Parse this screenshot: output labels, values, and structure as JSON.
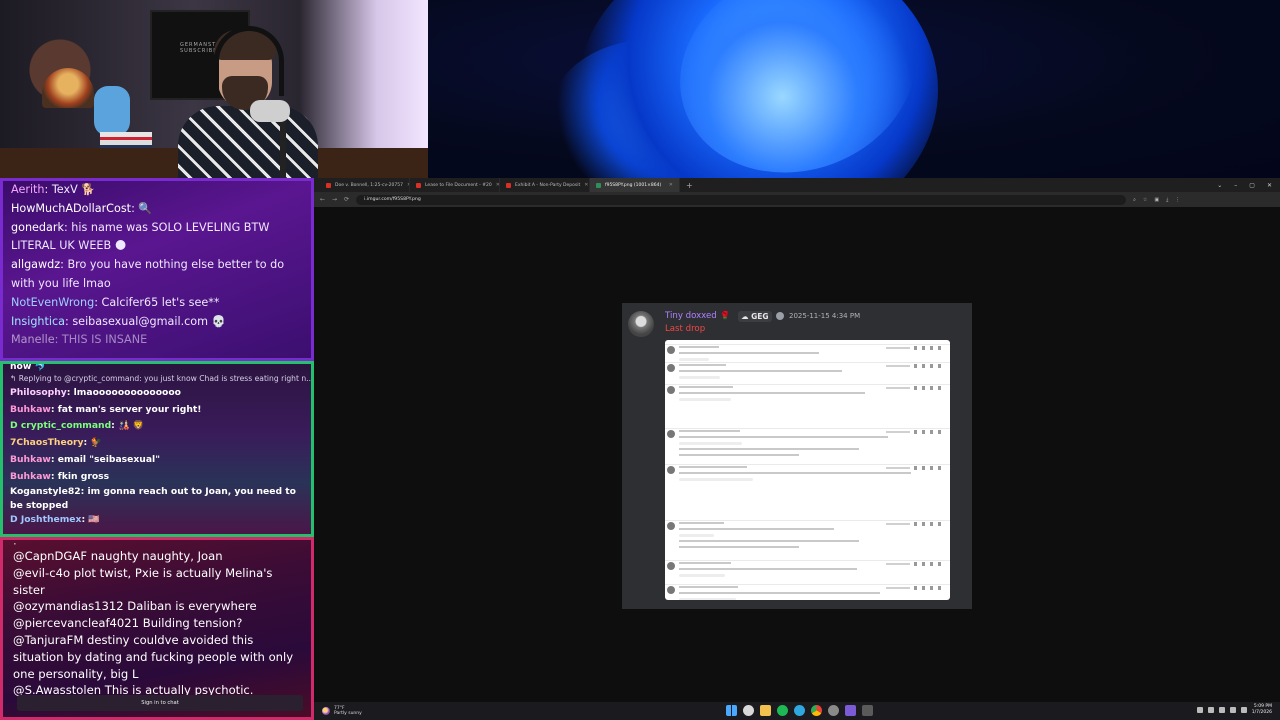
{
  "webcam": {
    "sign_text": "GERMANSTICK\nSUBSCRIBER"
  },
  "chat_top": {
    "messages": [
      {
        "user": "Aerith",
        "user_color": "#f6a6ff",
        "text": ": TexV 🐕"
      },
      {
        "user": "HowMuchADollarCost",
        "user_color": "#ffffff",
        "text": ":  🔍"
      },
      {
        "user": "gonedark",
        "user_color": "#ffffff",
        "text": ": his name was SOLO LEVELING BTW LITERAL UK WEEB 🌑"
      },
      {
        "user": "allgawdz",
        "user_color": "#ffffff",
        "text": ": Bro you have nothing else better to do with you life lmao"
      },
      {
        "user": "NotEvenWrong",
        "user_color": "#9fd0ff",
        "text": ": Calcifer65 let's see**"
      },
      {
        "user": "Insightica",
        "user_color": "#9fe6ff",
        "text": ": seibasexual@gmail.com 💀"
      },
      {
        "user": "Manelle",
        "user_color": "#ffffff",
        "text": ": THIS IS INSANE"
      }
    ]
  },
  "chat_mid": {
    "top_fragment": "now 🐬",
    "reply_to": "↰ Replying to @cryptic_command: you just know Chad is stress eating right n...",
    "messages": [
      {
        "user": "Philosophy",
        "user_color": "#ffd0ff",
        "text": ": lmaoooooooooooooo"
      },
      {
        "user": "Buhkaw",
        "user_color": "#ff9ad6",
        "text": ": fat man's server your right!"
      },
      {
        "user": "D cryptic_command",
        "user_color": "#7cff7c",
        "text": ": 🎎 🦁"
      },
      {
        "user": "7ChaosTheory",
        "user_color": "#ffd080",
        "text": ": 🐓"
      },
      {
        "user": "Buhkaw",
        "user_color": "#ff9ad6",
        "text": ": email \"seibasexual\""
      },
      {
        "user": "Buhkaw",
        "user_color": "#ff9ad6",
        "text": ": fkin gross"
      },
      {
        "user": "Koganstyle82",
        "user_color": "#ffffff",
        "text": ": im gonna reach out to Joan, you need to be stopped"
      },
      {
        "user": "D Joshthemex",
        "user_color": "#a0c8ff",
        "text": ": 🇺🇸"
      }
    ]
  },
  "chat_bottom": {
    "top_fragment": "·",
    "messages": [
      {
        "user": "@CapnDGAF",
        "text": " naughty naughty, Joan"
      },
      {
        "user": "@evil-c4o",
        "text": " plot twist, Pxie is actually Melina's sister"
      },
      {
        "user": "@ozymandias1312",
        "text": " Daliban is everywhere"
      },
      {
        "user": "@piercevancleaf4021",
        "text": " Building tension?"
      },
      {
        "user": "@TanjuraFM",
        "text": " destiny couldve avoided this situation by dating and fucking people with only one personality, big L"
      },
      {
        "user": "@S.Awasstolen",
        "text": " This is actually psychotic."
      }
    ],
    "signin_label": "Sign in to chat"
  },
  "browser": {
    "tabs": [
      {
        "label": "Doe v. Bonnell, 1:25-cv-20757",
        "active": false
      },
      {
        "label": "Lease to File Document - #20",
        "active": false
      },
      {
        "label": "Exhibit A - Non-Party Deposit",
        "active": false
      },
      {
        "label": "f95S8PY.png (1001×864)",
        "active": true
      }
    ],
    "new_tab": "+",
    "window_controls": [
      "⌄",
      "–",
      "▢",
      "✕"
    ],
    "url": "i.imgur.com/f95S8PY.png"
  },
  "discord": {
    "username": "Tiny doxxed",
    "server_tag": "GEG",
    "timestamp": "2025-11-15 4:34 PM",
    "message": "Last drop"
  },
  "taskbar": {
    "temp": "77°F",
    "condition": "Partly sunny",
    "time": "5:09 PM",
    "date": "1/7/2026"
  }
}
